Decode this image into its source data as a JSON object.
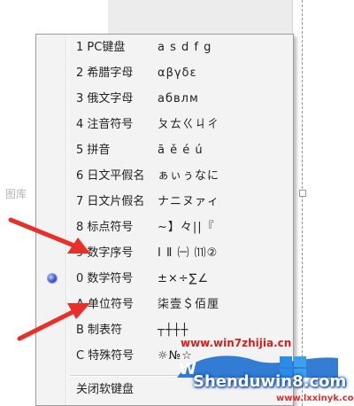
{
  "background": {
    "side_label": "图库"
  },
  "menu": {
    "items": [
      {
        "key": "1 PC键盘",
        "sample": "a s d f g",
        "selected": false
      },
      {
        "key": "2 希腊字母",
        "sample": "αβγδε",
        "selected": false
      },
      {
        "key": "3 俄文字母",
        "sample": "абвлм",
        "selected": false
      },
      {
        "key": "4 注音符号",
        "sample": "ㄆㄊㄍㄐㄔ",
        "selected": false
      },
      {
        "key": "5 拼音",
        "sample": "ā ě é ú",
        "selected": false
      },
      {
        "key": "6 日文平假名",
        "sample": "ぁぃぅなに",
        "selected": false
      },
      {
        "key": "7 日文片假名",
        "sample": "ナニヌァィ",
        "selected": false
      },
      {
        "key": "8 标点符号",
        "sample": "~】々||『",
        "selected": false
      },
      {
        "key": "9 数字序号",
        "sample": "Ⅰ Ⅱ ㈠ ⑾②",
        "selected": false
      },
      {
        "key": "0 数学符号",
        "sample": "±×÷∑∠",
        "selected": true
      },
      {
        "key": "A 单位符号",
        "sample": "柒壹＄佰厘",
        "selected": false
      },
      {
        "key": "B 制表符",
        "sample": "┬┼┼┼",
        "selected": false
      },
      {
        "key": "C 特殊符号",
        "sample": "☼№☆",
        "selected": false
      }
    ],
    "close_label": "关闭软键盘"
  },
  "watermark": {
    "site1": "www.win7zhijia.cn",
    "site2": "Shenduwin8.com",
    "site3": "www.lxxinyk.com"
  },
  "colors": {
    "arrow": "#e8302a",
    "radio_selected": "#3b54c8",
    "menu_bg": "#f3f3f3"
  }
}
